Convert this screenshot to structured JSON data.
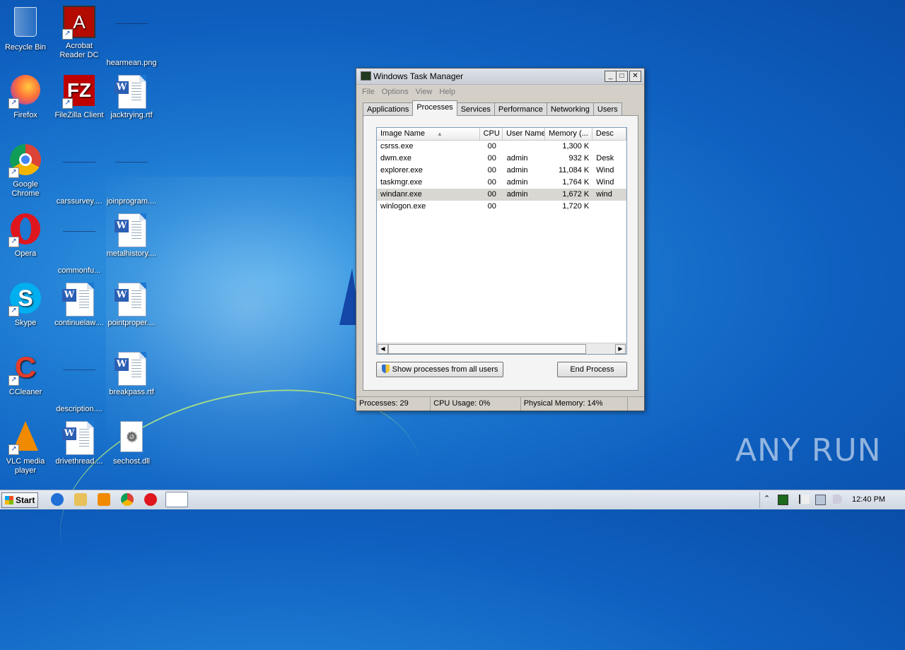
{
  "desktop": {
    "icons": [
      {
        "label": "Recycle Bin"
      },
      {
        "label": "Acrobat Reader DC"
      },
      {
        "label": "hearmean.png"
      },
      {
        "label": "Firefox"
      },
      {
        "label": "FileZilla Client"
      },
      {
        "label": "jacktrying.rtf"
      },
      {
        "label": "Google Chrome"
      },
      {
        "label": "carssurvey...."
      },
      {
        "label": "joinprogram...."
      },
      {
        "label": "Opera"
      },
      {
        "label": "commonfu..."
      },
      {
        "label": "metalhistory...."
      },
      {
        "label": "Skype"
      },
      {
        "label": "continuelaw...."
      },
      {
        "label": "pointproper...."
      },
      {
        "label": "CCleaner"
      },
      {
        "label": "description...."
      },
      {
        "label": "breakpass.rtf"
      },
      {
        "label": "VLC media player"
      },
      {
        "label": "drivethread...."
      },
      {
        "label": "sechost.dll"
      }
    ]
  },
  "window": {
    "title": "Windows Task Manager",
    "controls": {
      "minimize": "_",
      "maximize": "□",
      "close": "✕"
    },
    "menu": [
      "File",
      "Options",
      "View",
      "Help"
    ],
    "tabs": [
      "Applications",
      "Processes",
      "Services",
      "Performance",
      "Networking",
      "Users"
    ],
    "active_tab": "Processes",
    "columns": [
      "Image Name",
      "CPU",
      "User Name",
      "Memory (...",
      "Desc"
    ],
    "sort_indicator": "▲",
    "processes": [
      {
        "name": "csrss.exe",
        "cpu": "00",
        "user": "",
        "memory": "1,300 K",
        "desc": ""
      },
      {
        "name": "dwm.exe",
        "cpu": "00",
        "user": "admin",
        "memory": "932 K",
        "desc": "Desk"
      },
      {
        "name": "explorer.exe",
        "cpu": "00",
        "user": "admin",
        "memory": "11,084 K",
        "desc": "Wind"
      },
      {
        "name": "taskmgr.exe",
        "cpu": "00",
        "user": "admin",
        "memory": "1,764 K",
        "desc": "Wind"
      },
      {
        "name": "windanr.exe",
        "cpu": "00",
        "user": "admin",
        "memory": "1,672 K",
        "desc": "wind"
      },
      {
        "name": "winlogon.exe",
        "cpu": "00",
        "user": "",
        "memory": "1,720 K",
        "desc": ""
      }
    ],
    "selected_row": "windanr.exe",
    "show_all_button": "Show processes from all users",
    "end_process_button": "End Process",
    "status": {
      "processes": "Processes: 29",
      "cpu": "CPU Usage: 0%",
      "memory": "Physical Memory: 14%"
    }
  },
  "watermark": "ANY RUN",
  "taskbar": {
    "start_label": "Start",
    "clock": "12:40 PM"
  },
  "colors": {
    "desktop": "#1c78d0",
    "window_bg": "#d4d0c8",
    "selection": "#d9d7d2"
  }
}
